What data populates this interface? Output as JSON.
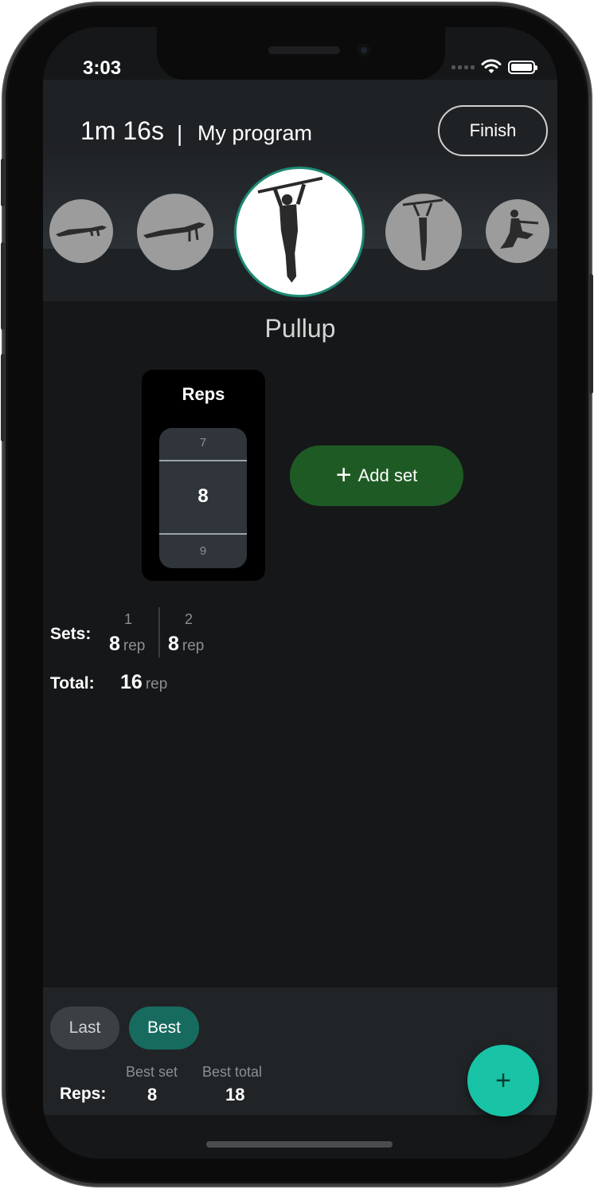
{
  "status_bar": {
    "time": "3:03"
  },
  "header": {
    "timer": "1m 16s",
    "separator": "|",
    "program": "My program",
    "finish_label": "Finish"
  },
  "exercises": [
    {
      "icon": "pushup-icon"
    },
    {
      "icon": "plank-icon"
    },
    {
      "icon": "pullup-icon",
      "active": true
    },
    {
      "icon": "hang-icon"
    },
    {
      "icon": "squat-icon"
    }
  ],
  "exercise_name": "Pullup",
  "picker": {
    "title": "Reps",
    "prev": "7",
    "current": "8",
    "next": "9"
  },
  "add_set": {
    "label": "Add set",
    "icon": "plus-icon"
  },
  "sets": {
    "label": "Sets:",
    "items": [
      {
        "num": "1",
        "value": "8",
        "unit": "rep"
      },
      {
        "num": "2",
        "value": "8",
        "unit": "rep"
      }
    ]
  },
  "total": {
    "label": "Total:",
    "value": "16",
    "unit": "rep"
  },
  "bottom": {
    "tabs": {
      "last": "Last",
      "best": "Best"
    },
    "row_label": "Reps:",
    "best_set_label": "Best set",
    "best_set_value": "8",
    "best_total_label": "Best total",
    "best_total_value": "18"
  },
  "fab_icon": "+",
  "colors": {
    "accent": "#18c3a6",
    "add_set": "#1e5b24",
    "best_tab": "#176b5e"
  }
}
